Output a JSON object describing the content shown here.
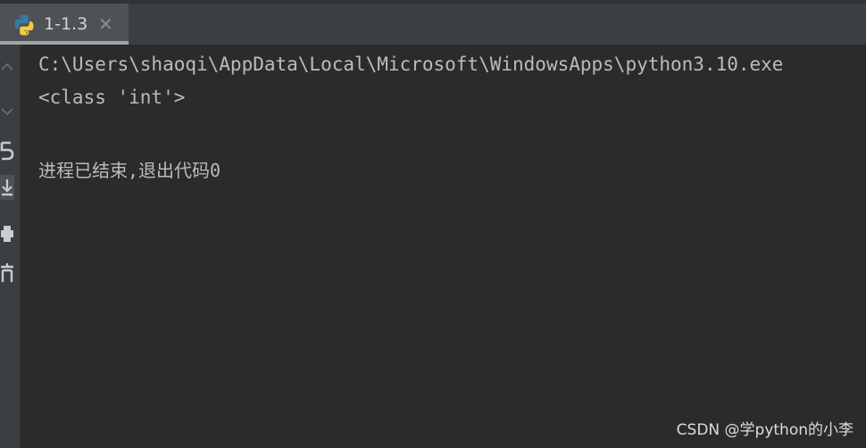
{
  "tab": {
    "title": "1-1.3",
    "close_glyph": "✕",
    "icon": "python-icon"
  },
  "toolbar": {
    "icons": [
      "scroll-up-icon",
      "scroll-down-icon",
      "rerun-icon",
      "scroll-to-end-icon",
      "print-icon",
      "delete-icon"
    ]
  },
  "console": {
    "command_line": "C:\\Users\\shaoqi\\AppData\\Local\\Microsoft\\WindowsApps\\python3.10.exe",
    "output_line": "<class 'int'>",
    "exit_line": "进程已结束,退出代码0"
  },
  "watermark": "CSDN @学python的小李",
  "colors": {
    "background": "#2b2b2b",
    "tabbar": "#3c3f41",
    "active_tab": "#4e5254",
    "text": "#bbbbbb"
  }
}
